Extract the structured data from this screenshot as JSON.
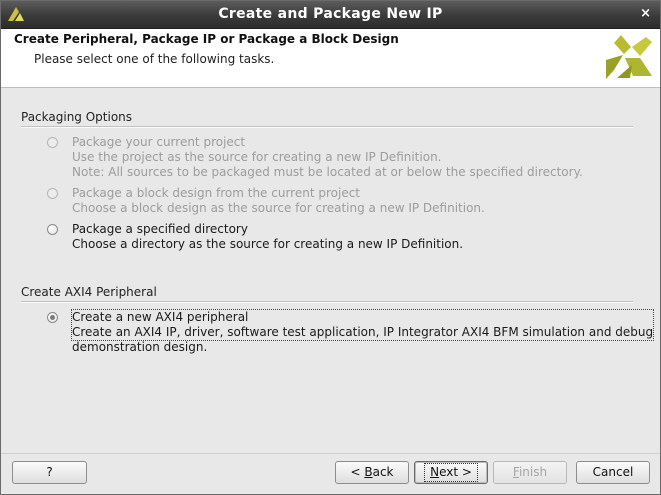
{
  "window": {
    "title": "Create and Package New IP",
    "close_glyph": "×"
  },
  "header": {
    "title": "Create Peripheral, Package IP or Package a Block Design",
    "subtitle": "Please select one of the following tasks."
  },
  "packaging": {
    "title": "Packaging Options",
    "options": [
      {
        "label": "Package your current project",
        "desc1": "Use the project as the source for creating a new IP Definition.",
        "desc2": "Note: All sources to be packaged must be located at or below the specified directory.",
        "enabled": false,
        "selected": false
      },
      {
        "label": "Package a block design from the current project",
        "desc1": "Choose a block design as the source for creating a new IP Definition.",
        "enabled": false,
        "selected": false
      },
      {
        "label": "Package a specified directory",
        "desc1": "Choose a directory as the source for creating a new IP Definition.",
        "enabled": true,
        "selected": false
      }
    ]
  },
  "axi": {
    "title": "Create AXI4 Peripheral",
    "option": {
      "label": "Create a new AXI4 peripheral",
      "desc1": "Create an AXI4 IP, driver, software test application, IP Integrator AXI4 BFM simulation and debug",
      "desc2": "demonstration design.",
      "enabled": true,
      "selected": true
    }
  },
  "buttons": {
    "help": "?",
    "back_mnemonic": "B",
    "back_rest": "ack",
    "back_prefix": "< ",
    "next_mnemonic": "N",
    "next_rest": "ext >",
    "finish_mnemonic": "F",
    "finish_rest": "inish",
    "cancel": "Cancel"
  },
  "colors": {
    "title_bar": "#3a3a3a",
    "logo_green": "#a8b02a"
  }
}
